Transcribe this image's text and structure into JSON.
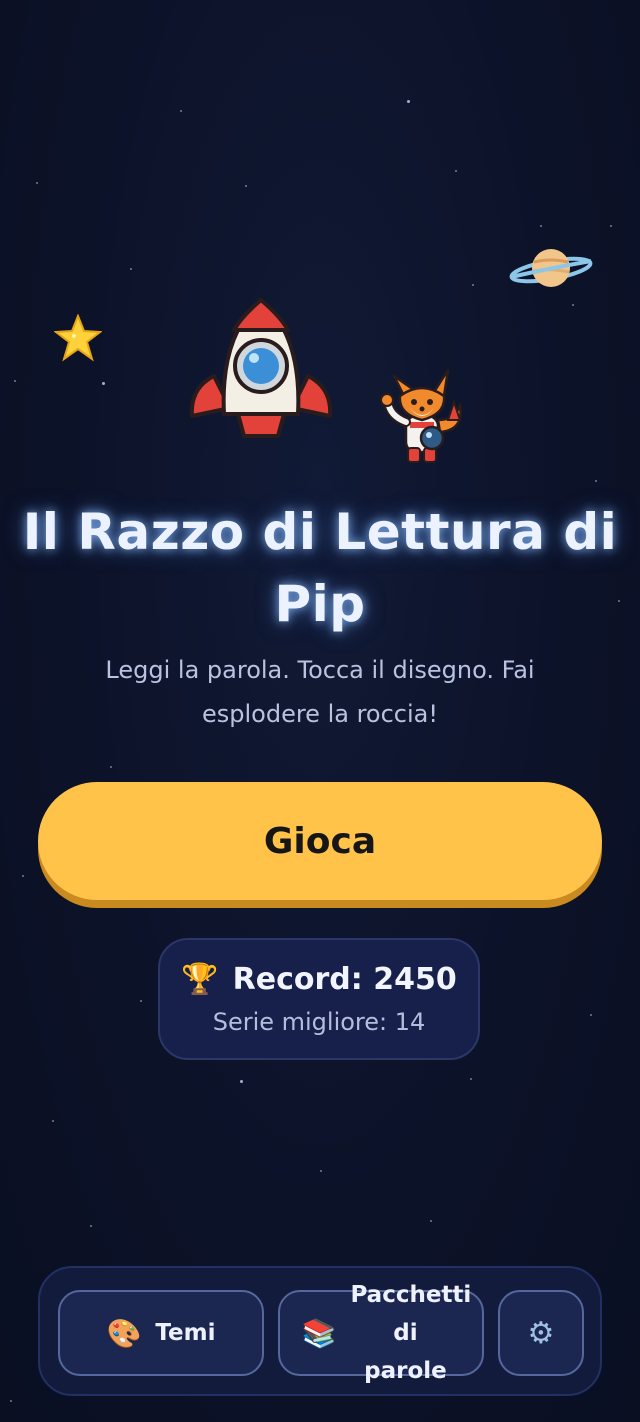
{
  "game": {
    "title": "Il Razzo di Lettura di Pip",
    "subtitle": "Leggi la parola. Tocca il disegno. Fai esplodere la roccia!",
    "play_label": "Gioca"
  },
  "stats": {
    "record_label": "Record: 2450",
    "streak_label": "Serie migliore: 14",
    "trophy_icon": "🏆"
  },
  "nav": {
    "themes_label": "Temi",
    "themes_icon": "🎨",
    "packs_label": "Pacchetti di parole",
    "packs_icon": "📚",
    "settings_icon": "⚙"
  },
  "colors": {
    "background": "#0c1228",
    "accent": "#ffc34a",
    "title_glow": "#8cbeff"
  }
}
